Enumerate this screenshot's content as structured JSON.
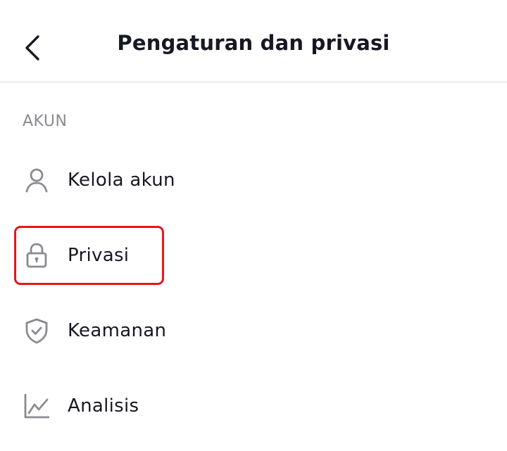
{
  "header": {
    "title": "Pengaturan dan privasi",
    "back_icon": "chevron-left-icon"
  },
  "section": {
    "label": "AKUN"
  },
  "menu": {
    "items": [
      {
        "label": "Kelola akun",
        "icon": "user-icon"
      },
      {
        "label": "Privasi",
        "icon": "lock-icon"
      },
      {
        "label": "Keamanan",
        "icon": "shield-check-icon"
      },
      {
        "label": "Analisis",
        "icon": "line-chart-icon"
      }
    ]
  },
  "colors": {
    "highlight": "#e5171c",
    "section_label": "#8a8b91",
    "icon": "#8a8b91",
    "text": "#161823"
  }
}
